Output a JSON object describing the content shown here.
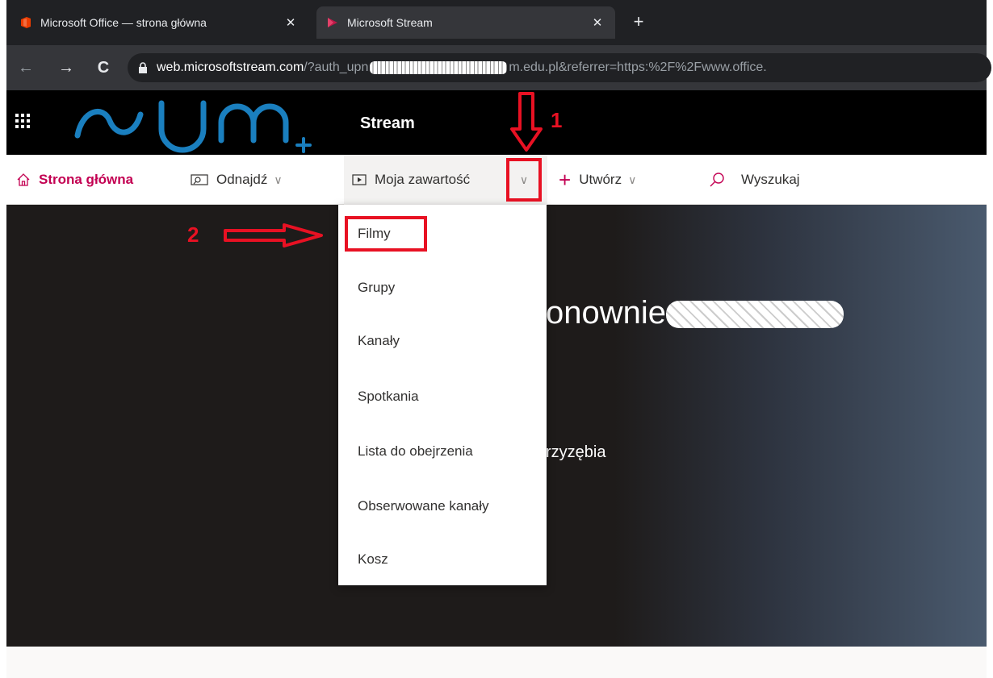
{
  "browser": {
    "tabs": [
      {
        "title": "Microsoft Office — strona główna",
        "icon": "office-icon",
        "active": false
      },
      {
        "title": "Microsoft Stream",
        "icon": "stream-icon",
        "active": true
      }
    ],
    "new_tab_label": "+",
    "close_label": "✕",
    "nav": {
      "back": "←",
      "forward": "→",
      "reload": "C"
    },
    "url": {
      "host": "web.microsoftstream.com",
      "path_start": "/?auth_upn",
      "path_end": "m.edu.pl&referrer=https:%2F%2Fwww.office."
    }
  },
  "suitebar": {
    "app_name": "Stream",
    "logo_text": "SUM+"
  },
  "navbar": {
    "home": "Strona główna",
    "find": "Odnajdź",
    "my_content": "Moja zawartość",
    "create": "Utwórz",
    "search": "Wyszukaj"
  },
  "dropdown": {
    "items": [
      "Filmy",
      "Grupy",
      "Kanały",
      "Spotkania",
      "Lista do obejrzenia",
      "Obserwowane kanały",
      "Kosz"
    ]
  },
  "hero": {
    "welcome_fragment": "onownie",
    "subtitle_fragment": "rzyzębia"
  },
  "annotations": {
    "step1": "1",
    "step2": "2"
  },
  "colors": {
    "accent": "#c30052",
    "annotation": "#e81123",
    "logo_blue": "#1a7fbf",
    "suitebar_bg": "#000000"
  }
}
